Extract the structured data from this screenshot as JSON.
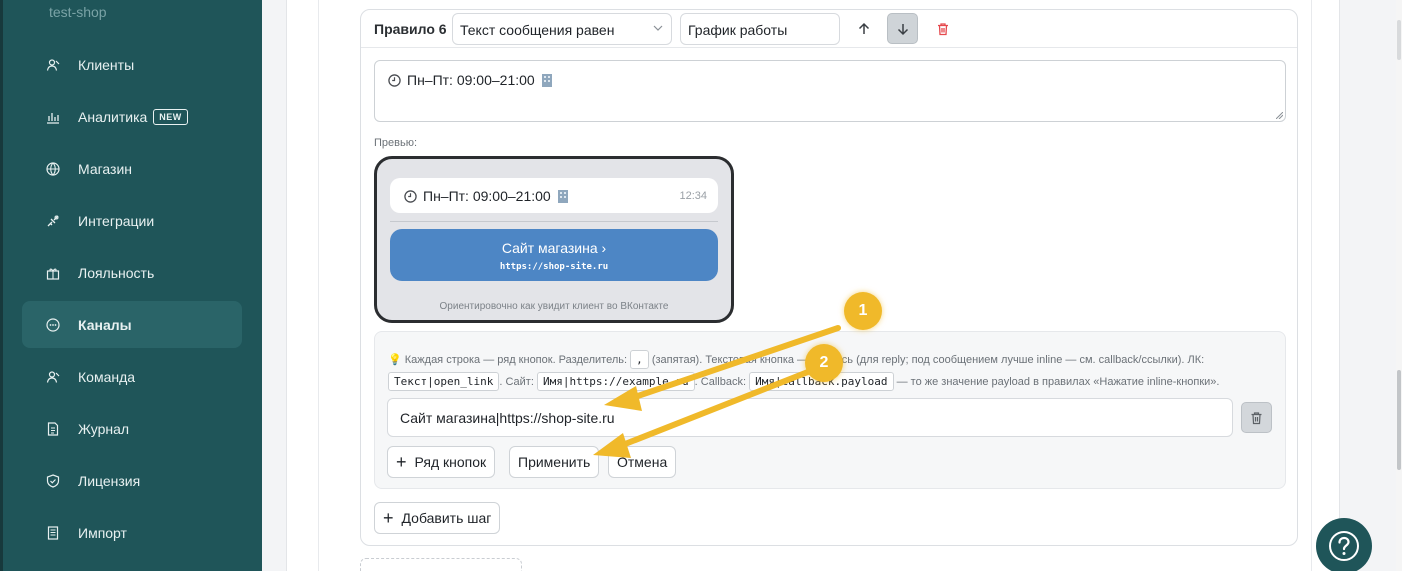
{
  "sidebar": {
    "brand": "test-shop",
    "items": [
      {
        "label": "Клиенты",
        "icon": "clients-icon"
      },
      {
        "label": "Аналитика",
        "icon": "analytics-icon",
        "badge": "NEW"
      },
      {
        "label": "Магазин",
        "icon": "globe-icon"
      },
      {
        "label": "Интеграции",
        "icon": "integrations-icon"
      },
      {
        "label": "Лояльность",
        "icon": "gift-icon"
      },
      {
        "label": "Каналы",
        "icon": "chat-icon",
        "active": true
      },
      {
        "label": "Команда",
        "icon": "team-icon"
      },
      {
        "label": "Журнал",
        "icon": "journal-icon"
      },
      {
        "label": "Лицензия",
        "icon": "shield-icon"
      },
      {
        "label": "Импорт",
        "icon": "import-icon"
      }
    ]
  },
  "rule": {
    "title": "Правило 6",
    "condition": "Текст сообщения равен",
    "value": "График работы",
    "message_text": "Пн–Пт: 09:00–21:00"
  },
  "preview": {
    "label": "Превью:",
    "bubble_text": "Пн–Пт: 09:00–21:00",
    "time": "12:34",
    "button_label": "Сайт магазина",
    "button_url": "https://shop-site.ru",
    "caption": "Ориентировочно как увидит клиент во ВКонтакте"
  },
  "keyboard": {
    "hint_1": "Каждая строка — ряд кнопок. Разделитель:",
    "sep": ",",
    "hint_2": "(запятая). Текстовая кнопка — надпись (для reply; под сообщением лучше inline — см. callback/ссылки). ЛК:",
    "code_text": "Текст|open_link",
    "hint_site": ". Сайт:",
    "code_site": "Имя|https://example.ru",
    "hint_cb": ". Callback:",
    "code_cb": "Имя|callback.payload",
    "hint_3": "— то же значение payload в правилах «Нажатие inline-кнопки».",
    "row_value": "Сайт магазина|https://shop-site.ru",
    "add_row": "Ряд кнопок",
    "apply": "Применить",
    "cancel": "Отмена"
  },
  "add_step": "Добавить шаг",
  "annotations": {
    "marker_1": "1",
    "marker_2": "2"
  },
  "colors": {
    "sidebar": "#1f5559",
    "accent": "#f0b92a",
    "vk_button": "#4d86c5",
    "delete": "#e5484d"
  }
}
